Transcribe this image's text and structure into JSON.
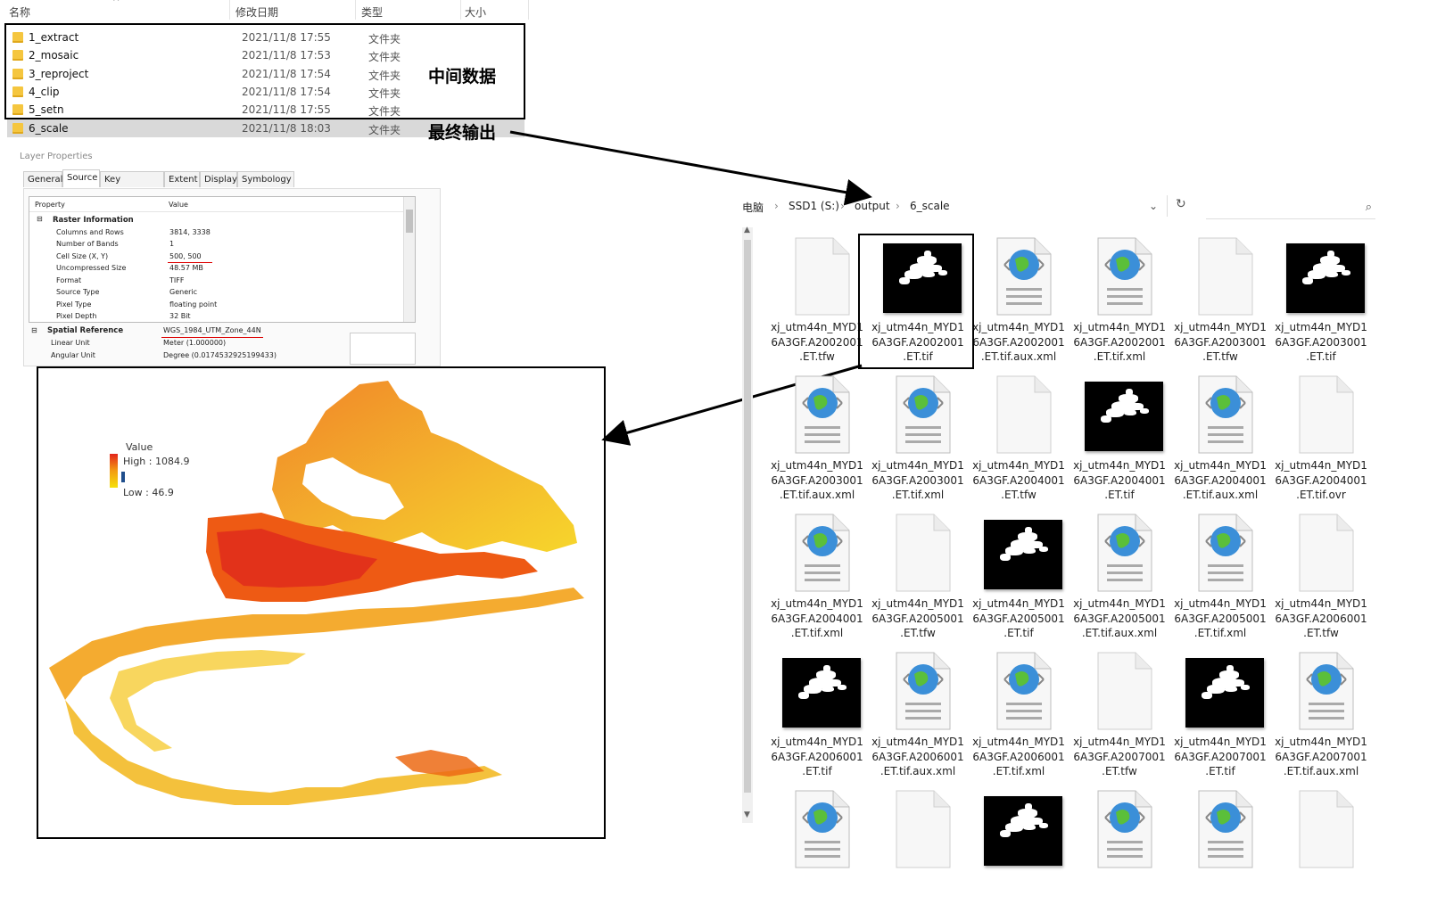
{
  "folder_list": {
    "columns": {
      "name": "名称",
      "date": "修改日期",
      "type": "类型",
      "size": "大小"
    },
    "rows": [
      {
        "name": "1_extract",
        "date": "2021/11/8 17:55",
        "type": "文件夹"
      },
      {
        "name": "2_mosaic",
        "date": "2021/11/8 17:53",
        "type": "文件夹"
      },
      {
        "name": "3_reproject",
        "date": "2021/11/8 17:54",
        "type": "文件夹"
      },
      {
        "name": "4_clip",
        "date": "2021/11/8 17:54",
        "type": "文件夹"
      },
      {
        "name": "5_setn",
        "date": "2021/11/8 17:55",
        "type": "文件夹"
      },
      {
        "name": "6_scale",
        "date": "2021/11/8 18:03",
        "type": "文件夹"
      }
    ],
    "annotation_intermediate": "中间数据",
    "annotation_final": "最终输出"
  },
  "layer_properties": {
    "title": "Layer Properties",
    "tabs": [
      "General",
      "Source",
      "Key Metadata",
      "Extent",
      "Display",
      "Symbology"
    ],
    "active_tab": "Source",
    "header": {
      "property": "Property",
      "value": "Value"
    },
    "raster_section": "Raster Information",
    "raster_rows": [
      {
        "p": "Columns and Rows",
        "v": "3814, 3338"
      },
      {
        "p": "Number of Bands",
        "v": "1"
      },
      {
        "p": "Cell Size (X, Y)",
        "v": "500, 500"
      },
      {
        "p": "Uncompressed Size",
        "v": "48.57 MB"
      },
      {
        "p": "Format",
        "v": "TIFF"
      },
      {
        "p": "Source Type",
        "v": "Generic"
      },
      {
        "p": "Pixel Type",
        "v": "floating point"
      },
      {
        "p": "Pixel Depth",
        "v": "32 Bit"
      }
    ],
    "spatial_section": "Spatial Reference",
    "spatial_value": "WGS_1984_UTM_Zone_44N",
    "spatial_rows": [
      {
        "p": "Linear Unit",
        "v": "Meter (1.000000)"
      },
      {
        "p": "Angular Unit",
        "v": "Degree (0.0174532925199433)"
      }
    ]
  },
  "map": {
    "legend_title": "Value",
    "legend_high": "High : 1084.9",
    "legend_low": "Low : 46.9",
    "colors": {
      "high": "#e3241b",
      "mid": "#f39c12",
      "low": "#f5e00a"
    }
  },
  "explorer": {
    "breadcrumb": [
      "电脑",
      "SSD1 (S:)",
      "output",
      "6_scale"
    ],
    "refresh_icon": "refresh-icon",
    "search_icon": "search-icon",
    "files": [
      {
        "name": "xj_utm44n_MYD16A3GF.A2002001.ET.tfw",
        "kind": "blank",
        "lines": [
          "xj_utm44n_MYD1",
          "6A3GF.A2002001",
          ".ET.tfw"
        ]
      },
      {
        "name": "xj_utm44n_MYD16A3GF.A2002001.ET.tif",
        "kind": "tif",
        "lines": [
          "xj_utm44n_MYD1",
          "6A3GF.A2002001",
          ".ET.tif"
        ],
        "selected": true
      },
      {
        "name": "xj_utm44n_MYD16A3GF.A2002001.ET.tif.aux.xml",
        "kind": "xml",
        "lines": [
          "xj_utm44n_MYD1",
          "6A3GF.A2002001",
          ".ET.tif.aux.xml"
        ]
      },
      {
        "name": "xj_utm44n_MYD16A3GF.A2002001.ET.tif.xml",
        "kind": "xml",
        "lines": [
          "xj_utm44n_MYD1",
          "6A3GF.A2002001",
          ".ET.tif.xml"
        ]
      },
      {
        "name": "xj_utm44n_MYD16A3GF.A2003001.ET.tfw",
        "kind": "blank",
        "lines": [
          "xj_utm44n_MYD1",
          "6A3GF.A2003001",
          ".ET.tfw"
        ]
      },
      {
        "name": "xj_utm44n_MYD16A3GF.A2003001.ET.tif",
        "kind": "tif",
        "lines": [
          "xj_utm44n_MYD1",
          "6A3GF.A2003001",
          ".ET.tif"
        ]
      },
      {
        "name": "xj_utm44n_MYD16A3GF.A2003001.ET.tif.aux.xml",
        "kind": "xml",
        "lines": [
          "xj_utm44n_MYD1",
          "6A3GF.A2003001",
          ".ET.tif.aux.xml"
        ]
      },
      {
        "name": "xj_utm44n_MYD16A3GF.A2003001.ET.tif.xml",
        "kind": "xml",
        "lines": [
          "xj_utm44n_MYD1",
          "6A3GF.A2003001",
          ".ET.tif.xml"
        ]
      },
      {
        "name": "xj_utm44n_MYD16A3GF.A2004001.ET.tfw",
        "kind": "blank",
        "lines": [
          "xj_utm44n_MYD1",
          "6A3GF.A2004001",
          ".ET.tfw"
        ]
      },
      {
        "name": "xj_utm44n_MYD16A3GF.A2004001.ET.tif",
        "kind": "tif",
        "lines": [
          "xj_utm44n_MYD1",
          "6A3GF.A2004001",
          ".ET.tif"
        ]
      },
      {
        "name": "xj_utm44n_MYD16A3GF.A2004001.ET.tif.aux.xml",
        "kind": "xml",
        "lines": [
          "xj_utm44n_MYD1",
          "6A3GF.A2004001",
          ".ET.tif.aux.xml"
        ]
      },
      {
        "name": "xj_utm44n_MYD16A3GF.A2004001.ET.tif.ovr",
        "kind": "blank",
        "lines": [
          "xj_utm44n_MYD1",
          "6A3GF.A2004001",
          ".ET.tif.ovr"
        ]
      },
      {
        "name": "xj_utm44n_MYD16A3GF.A2004001.ET.tif.xml",
        "kind": "xml",
        "lines": [
          "xj_utm44n_MYD1",
          "6A3GF.A2004001",
          ".ET.tif.xml"
        ]
      },
      {
        "name": "xj_utm44n_MYD16A3GF.A2005001.ET.tfw",
        "kind": "blank",
        "lines": [
          "xj_utm44n_MYD1",
          "6A3GF.A2005001",
          ".ET.tfw"
        ]
      },
      {
        "name": "xj_utm44n_MYD16A3GF.A2005001.ET.tif",
        "kind": "tif",
        "lines": [
          "xj_utm44n_MYD1",
          "6A3GF.A2005001",
          ".ET.tif"
        ]
      },
      {
        "name": "xj_utm44n_MYD16A3GF.A2005001.ET.tif.aux.xml",
        "kind": "xml",
        "lines": [
          "xj_utm44n_MYD1",
          "6A3GF.A2005001",
          ".ET.tif.aux.xml"
        ]
      },
      {
        "name": "xj_utm44n_MYD16A3GF.A2005001.ET.tif.xml",
        "kind": "xml",
        "lines": [
          "xj_utm44n_MYD1",
          "6A3GF.A2005001",
          ".ET.tif.xml"
        ]
      },
      {
        "name": "xj_utm44n_MYD16A3GF.A2006001.ET.tfw",
        "kind": "blank",
        "lines": [
          "xj_utm44n_MYD1",
          "6A3GF.A2006001",
          ".ET.tfw"
        ]
      },
      {
        "name": "xj_utm44n_MYD16A3GF.A2006001.ET.tif",
        "kind": "tif",
        "lines": [
          "xj_utm44n_MYD1",
          "6A3GF.A2006001",
          ".ET.tif"
        ]
      },
      {
        "name": "xj_utm44n_MYD16A3GF.A2006001.ET.tif.aux.xml",
        "kind": "xml",
        "lines": [
          "xj_utm44n_MYD1",
          "6A3GF.A2006001",
          ".ET.tif.aux.xml"
        ]
      },
      {
        "name": "xj_utm44n_MYD16A3GF.A2006001.ET.tif.xml",
        "kind": "xml",
        "lines": [
          "xj_utm44n_MYD1",
          "6A3GF.A2006001",
          ".ET.tif.xml"
        ]
      },
      {
        "name": "xj_utm44n_MYD16A3GF.A2007001.ET.tfw",
        "kind": "blank",
        "lines": [
          "xj_utm44n_MYD1",
          "6A3GF.A2007001",
          ".ET.tfw"
        ]
      },
      {
        "name": "xj_utm44n_MYD16A3GF.A2007001.ET.tif",
        "kind": "tif",
        "lines": [
          "xj_utm44n_MYD1",
          "6A3GF.A2007001",
          ".ET.tif"
        ]
      },
      {
        "name": "xj_utm44n_MYD16A3GF.A2007001.ET.tif.aux.xml",
        "kind": "xml",
        "lines": [
          "xj_utm44n_MYD1",
          "6A3GF.A2007001",
          ".ET.tif.aux.xml"
        ]
      },
      {
        "kind": "xml",
        "lines": []
      },
      {
        "kind": "blank",
        "lines": []
      },
      {
        "kind": "tif",
        "lines": []
      },
      {
        "kind": "xml",
        "lines": []
      },
      {
        "kind": "xml",
        "lines": []
      },
      {
        "kind": "blank",
        "lines": []
      }
    ]
  }
}
